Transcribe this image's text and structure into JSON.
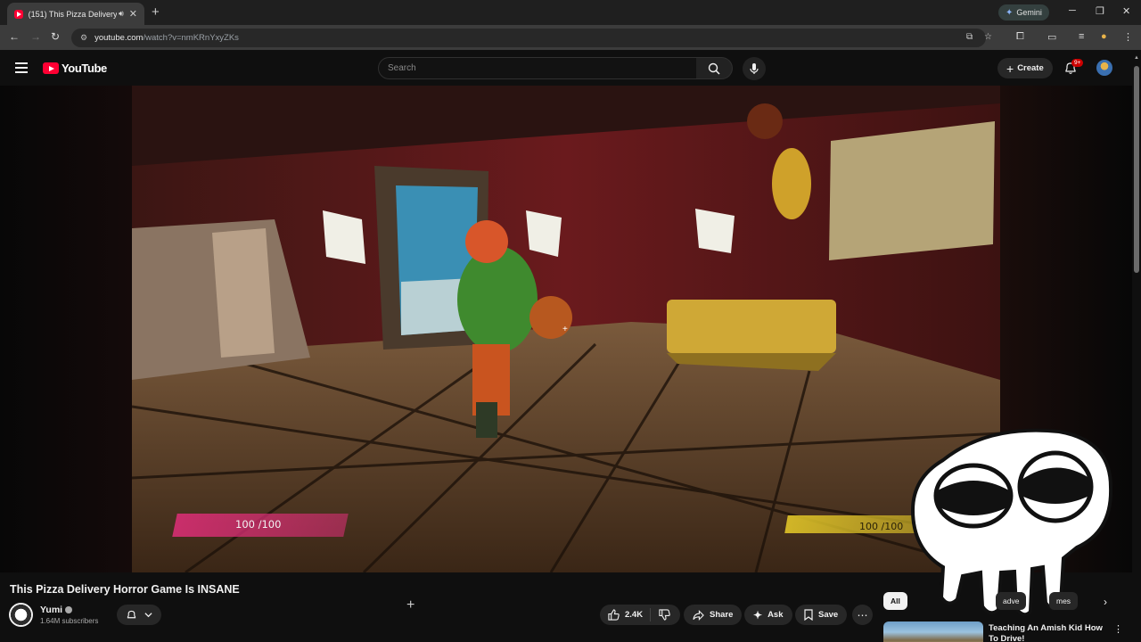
{
  "browser": {
    "tab_title": "(151) This Pizza Delivery Ho",
    "new_tab": "+",
    "gemini_label": "Gemini",
    "url_host": "youtube.com",
    "url_path": "/watch?v=nmKRnYxyZKs"
  },
  "masthead": {
    "logo_text": "YouTube",
    "search_placeholder": "Search",
    "create_label": "Create",
    "notif_badge": "9+"
  },
  "player": {
    "health_text": "100 /100",
    "stamina_text": "100 /100"
  },
  "video": {
    "title": "This Pizza Delivery Horror Game Is INSANE",
    "channel": "Yumi",
    "subscribers": "1.64M subscribers",
    "likes": "2.4K",
    "share_label": "Share",
    "ask_label": "Ask",
    "save_label": "Save"
  },
  "chips": [
    "All",
    "adve",
    "mes"
  ],
  "recommendation": {
    "title": "Teaching An Amish Kid How To Drive!"
  },
  "icons": {
    "hamburger": "menu-icon",
    "search": "search-icon",
    "mic": "mic-icon",
    "bell": "bell-icon",
    "like": "thumbs-up-icon",
    "dislike": "thumbs-down-icon",
    "share": "share-icon",
    "ask": "sparkle-icon",
    "save": "bookmark-icon"
  },
  "colors": {
    "brand_red": "#ff0033",
    "health_bar": "#e02e78",
    "stamina_bar": "#e0c428"
  }
}
